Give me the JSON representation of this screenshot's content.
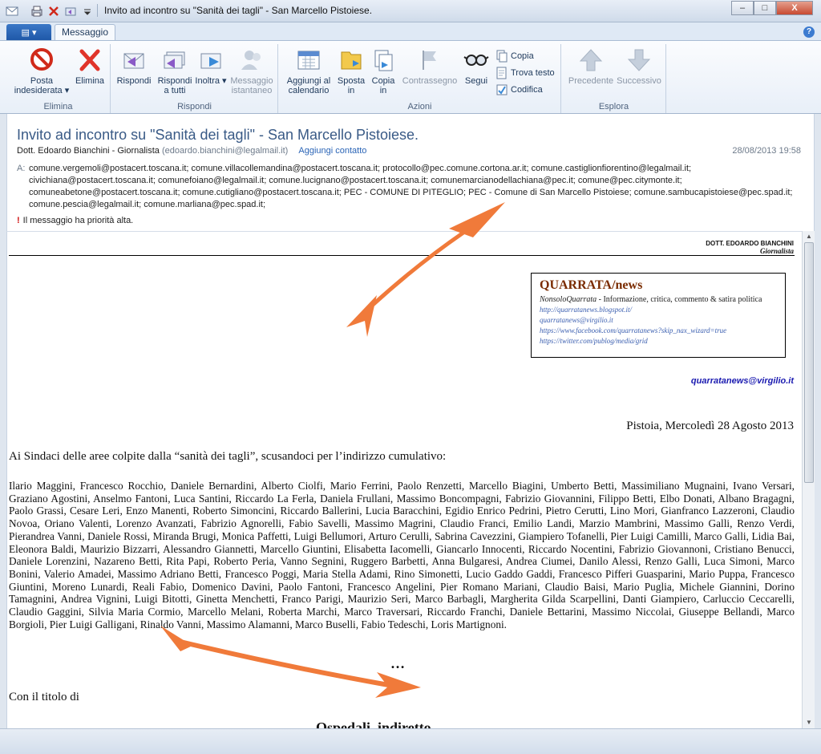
{
  "window": {
    "title": "Invito ad incontro su \"Sanità dei tagli\" - San Marcello Pistoiese.",
    "controls": {
      "minimize": "–",
      "maximize": "□",
      "close": "X"
    }
  },
  "ribbon": {
    "file_tab": "▤ ▾",
    "active_tab": "Messaggio",
    "help": "?",
    "groups": {
      "elimina": "Elimina",
      "rispondi": "Rispondi",
      "azioni": "Azioni",
      "esplora": "Esplora"
    },
    "buttons": {
      "posta_indesiderata": "Posta indesiderata ▾",
      "elimina": "Elimina",
      "rispondi": "Rispondi",
      "rispondi_tutti": "Rispondi a tutti",
      "inoltra": "Inoltra ▾",
      "messaggio_istantaneo": "Messaggio istantaneo",
      "aggiungi_calendario": "Aggiungi al calendario",
      "sposta_in": "Sposta in",
      "copia_in": "Copia in",
      "contrassegno": "Contrassegno",
      "segui": "Segui",
      "copia": "Copia",
      "trova_testo": "Trova testo",
      "codifica": "Codifica",
      "precedente": "Precedente",
      "successivo": "Successivo"
    }
  },
  "message": {
    "subject": "Invito ad incontro su \"Sanità dei tagli\" - San Marcello Pistoiese.",
    "sender_name": "Dott. Edoardo Bianchini - Giornalista",
    "sender_email": "(edoardo.bianchini@legalmail.it)",
    "add_contact": "Aggiungi contatto",
    "date": "28/08/2013 19:58",
    "to_label": "A:",
    "recipients": "comune.vergemoli@postacert.toscana.it; comune.villacollemandina@postacert.toscana.it; protocollo@pec.comune.cortona.ar.it; comune.castiglionfiorentino@legalmail.it; civichiana@postacert.toscana.it; comunefoiano@legalmail.it; comune.lucignano@postacert.toscana.it; comunemarcianodellachiana@pec.it; comune@pec.citymonte.it; comuneabetone@postacert.toscana.it; comune.cutigliano@postacert.toscana.it; PEC - COMUNE DI PITEGLIO; PEC - Comune di San Marcello Pistoiese; comune.sambucapistoiese@pec.spad.it; comune.pescia@legalmail.it; comune.marliana@pec.spad.it;",
    "priority": "Il messaggio ha priorità alta."
  },
  "body": {
    "letterhead_name": "DOTT. EDOARDO BIANCHINI",
    "letterhead_role": "Giornalista",
    "box": {
      "title": "QUARRATA/news",
      "brand": "NonsoloQuarrata",
      "desc": " - Informazione, critica, commento & satira politica",
      "links": [
        "http://quarratanews.blogspot.it/",
        "quarratanews@virgilio.it",
        "https://www.facebook.com/quarratanews?skip_nax_wizard=true",
        "https://twitter.com/publog/media/grid"
      ]
    },
    "contact_email": "quarratanews@virgilio.it",
    "dateline": "Pistoia, Mercoledì 28 Agosto 2013",
    "greeting": "Ai Sindaci delle aree colpite dalla “sanità dei tagli”, scusandoci per l’indirizzo cumulativo:",
    "names": "Ilario Maggini, Francesco Rocchio, Daniele Bernardini, Alberto Ciolfi, Mario Ferrini, Paolo Renzetti, Marcello Biagini, Umberto Betti, Massimiliano Mugnaini, Ivano Versari, Graziano Agostini, Anselmo Fantoni, Luca Santini, Riccardo La Ferla, Daniela Frullani, Massimo Boncompagni, Fabrizio Giovannini, Filippo Betti, Elbo Donati, Albano Bragagni, Paolo Grassi, Cesare Leri, Enzo Manenti, Roberto Simoncini, Riccardo Ballerini, Lucia Baracchini, Egidio Enrico Pedrini, Pietro Cerutti, Lino Mori, Gianfranco Lazzeroni, Claudio Novoa, Oriano Valenti, Lorenzo Avanzati, Fabrizio Agnorelli, Fabio Savelli, Massimo Magrini, Claudio Franci, Emilio Landi, Marzio Mambrini, Massimo Galli, Renzo Verdi, Pierandrea Vanni, Daniele Rossi, Miranda Brugi, Monica Paffetti, Luigi Bellumori, Arturo Cerulli, Sabrina Cavezzini, Giampiero Tofanelli, Pier Luigi Camilli, Marco Galli, Lidia Bai, Eleonora Baldi, Maurizio Bizzarri, Alessandro Giannetti, Marcello Giuntini, Elisabetta Iacomelli, Giancarlo Innocenti, Riccardo Nocentini, Fabrizio Giovannoni, Cristiano Benucci, Daniele Lorenzini, Nazareno Betti, Rita Papi, Roberto Peria, Vanno Segnini, Ruggero Barbetti, Anna Bulgaresi, Andrea Ciumei, Danilo Alessi, Renzo Galli, Luca Simoni, Marco Bonini, Valerio Amadei, Massimo Adriano Betti, Francesco Poggi, Maria Stella Adami, Rino Simonetti, Lucio Gaddo Gaddi, Francesco Pifferi Guasparini, Mario Puppa, Francesco Giuntini, Moreno Lunardi, Reali Fabio, Domenico Davini, Paolo Fantoni, Francesco Angelini, Pier Romano Mariani, Claudio Baisi, Mario Puglia, Michele Giannini, Dorino Tamagnini, Andrea Vignini, Luigi Bitotti, Ginetta Menchetti, Franco Parigi, Maurizio Seri, Marco Barbagli, Margherita Gilda Scarpellini, Danti Giampiero, Carluccio Ceccarelli, Claudio Gaggini, Silvia Maria Cormio, Marcello Melani, Roberta Marchi, Marco Traversari, Riccardo Franchi, Daniele Bettarini, Massimo Niccolai, Giuseppe Bellandi, Marco Borgioli, Pier Luigi Galligani, Rinaldo Vanni, Massimo Alamanni, Marco Buselli, Fabio Tedeschi, Loris Martignoni.",
    "dots": "…",
    "titolo": "Con il titolo di",
    "heading_cut": "Ospedali, indiretto"
  },
  "colors": {
    "ribbon_text": "#1e395b",
    "subject_blue": "#395a86",
    "arrow_orange": "#f07a3a",
    "link_blue": "#3b5fb0"
  }
}
